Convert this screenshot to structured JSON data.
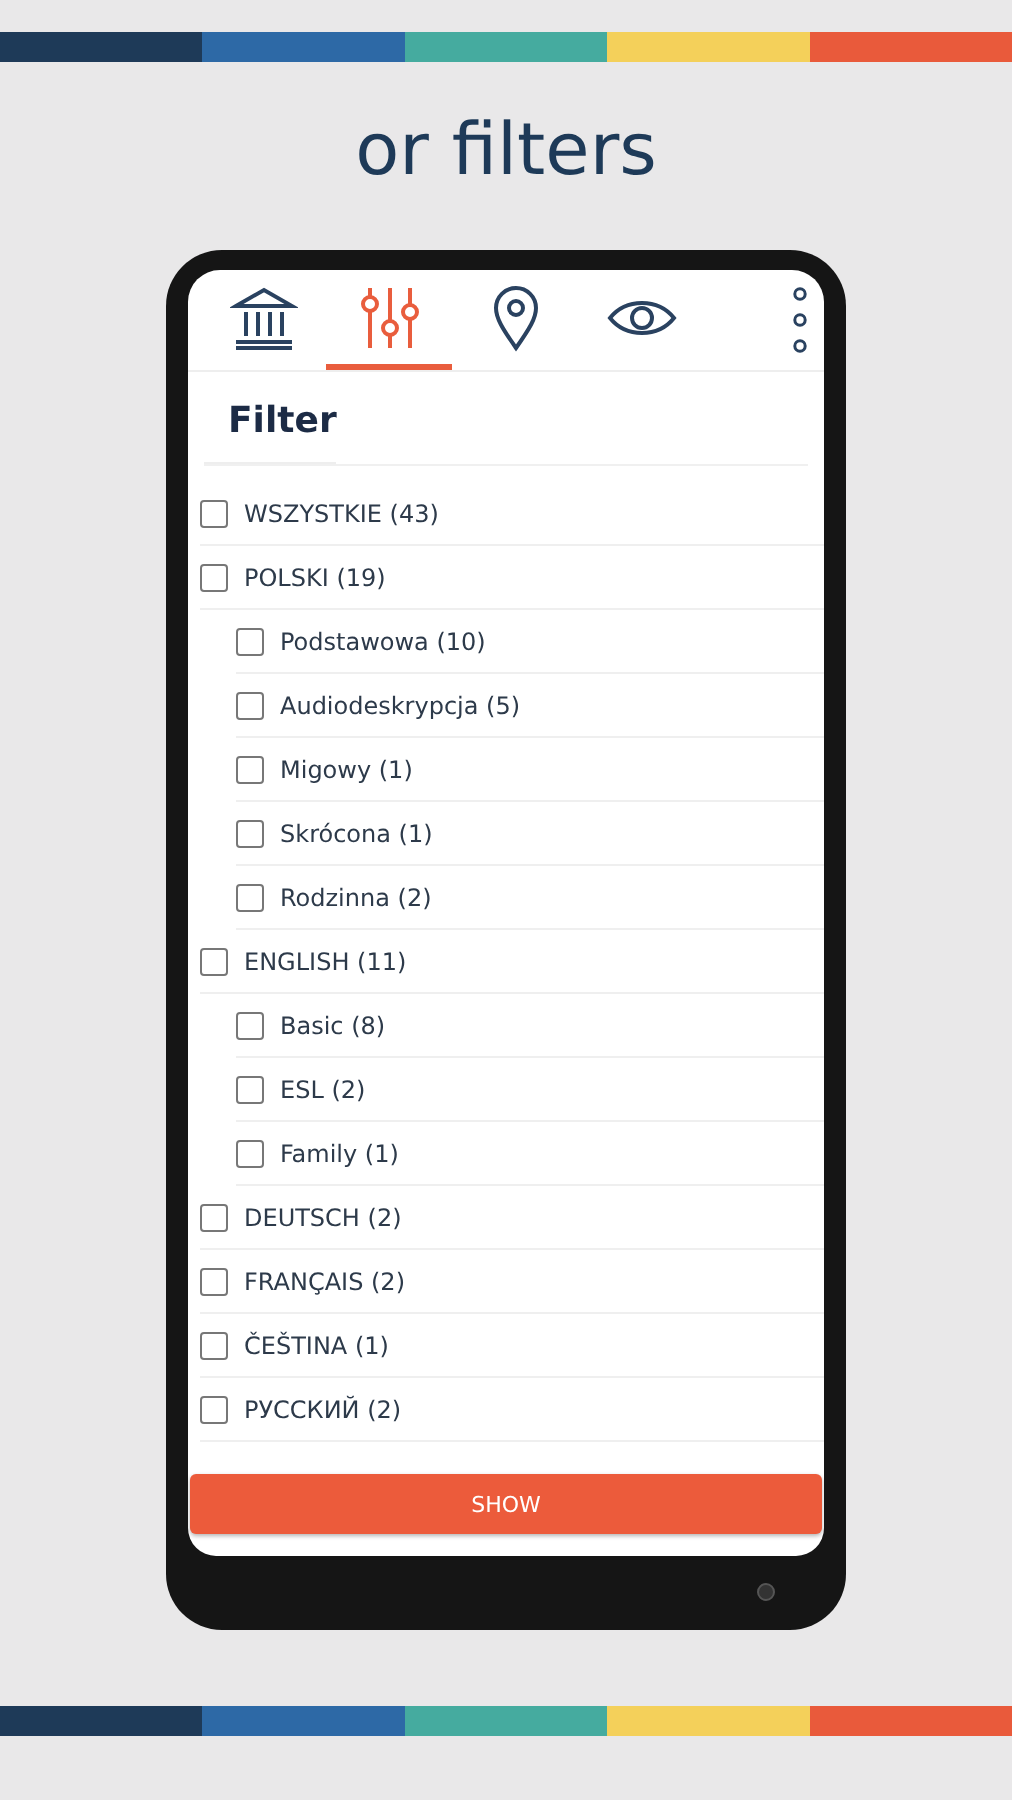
{
  "headline": "or filters",
  "tabs": [
    {
      "kind": "museum",
      "selected": false
    },
    {
      "kind": "sliders",
      "selected": true
    },
    {
      "kind": "pin",
      "selected": false
    },
    {
      "kind": "eye",
      "selected": false
    }
  ],
  "title": "Filter",
  "filters": [
    {
      "label": "WSZYSTKIE (43)",
      "checked": false
    },
    {
      "label": "POLSKI (19)",
      "checked": false,
      "children": [
        {
          "label": "Podstawowa (10)",
          "checked": false
        },
        {
          "label": "Audiodeskrypcja (5)",
          "checked": false
        },
        {
          "label": "Migowy (1)",
          "checked": false
        },
        {
          "label": "Skrócona (1)",
          "checked": false
        },
        {
          "label": "Rodzinna (2)",
          "checked": false
        }
      ]
    },
    {
      "label": "ENGLISH (11)",
      "checked": false,
      "children": [
        {
          "label": "Basic (8)",
          "checked": false
        },
        {
          "label": "ESL (2)",
          "checked": false
        },
        {
          "label": "Family (1)",
          "checked": false
        }
      ]
    },
    {
      "label": "DEUTSCH (2)",
      "checked": false
    },
    {
      "label": "FRANÇAIS (2)",
      "checked": false
    },
    {
      "label": "ČEŠTINA (1)",
      "checked": false
    },
    {
      "label": "РУССКИЙ (2)",
      "checked": false
    }
  ],
  "button": "SHOW"
}
